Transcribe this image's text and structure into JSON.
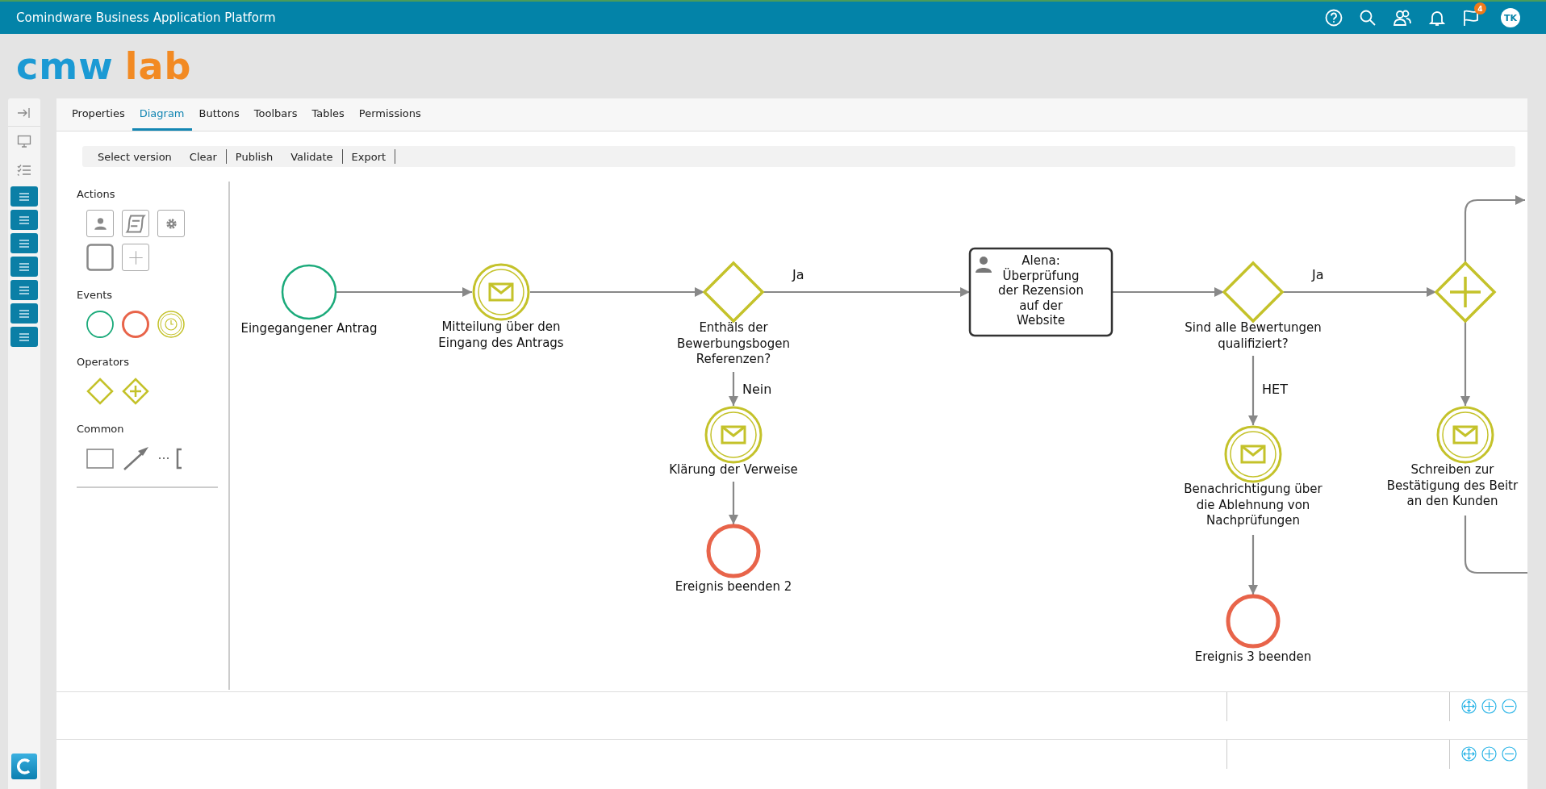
{
  "topbar": {
    "title": "Comindware Business Application Platform",
    "badge": "4",
    "user_initials": "TK"
  },
  "logo": {
    "part_1": "cmw",
    "part_2": "lab"
  },
  "rail": [
    {
      "kind": "collapse"
    },
    {
      "kind": "monitor"
    },
    {
      "kind": "checklist"
    },
    {
      "kind": "menu"
    },
    {
      "kind": "menu"
    },
    {
      "kind": "menu"
    },
    {
      "kind": "menu"
    },
    {
      "kind": "menu"
    },
    {
      "kind": "menu"
    },
    {
      "kind": "menu"
    },
    {
      "kind": "app"
    }
  ],
  "tabs": [
    {
      "label": "Properties",
      "selected": false
    },
    {
      "label": "Diagram",
      "selected": true
    },
    {
      "label": "Buttons",
      "selected": false
    },
    {
      "label": "Toolbars",
      "selected": false
    },
    {
      "label": "Tables",
      "selected": false
    },
    {
      "label": "Permissions",
      "selected": false
    }
  ],
  "toolbar": [
    {
      "label": "Select version",
      "separator": false
    },
    {
      "label": "Clear",
      "separator": true
    },
    {
      "label": "Publish",
      "separator": false
    },
    {
      "label": "Validate",
      "separator": true
    },
    {
      "label": "Export",
      "separator": true
    }
  ],
  "palette": [
    {
      "title": "Actions",
      "items": [
        {
          "kind": "user-task"
        },
        {
          "kind": "script-task"
        },
        {
          "kind": "service-task"
        },
        {
          "kind": "task"
        },
        {
          "kind": "add"
        }
      ]
    },
    {
      "title": "Events",
      "items": [
        {
          "kind": "start"
        },
        {
          "kind": "end"
        },
        {
          "kind": "timer"
        }
      ]
    },
    {
      "title": "Operators",
      "items": [
        {
          "kind": "gateway"
        },
        {
          "kind": "parallel"
        }
      ]
    },
    {
      "title": "Common",
      "items": [
        {
          "kind": "rectangle"
        },
        {
          "kind": "arrow"
        },
        {
          "kind": "annotation"
        }
      ]
    }
  ],
  "diagram": {
    "nodes": [
      {
        "kind": "start",
        "label": "Eingegangener Antrag"
      },
      {
        "kind": "message",
        "label": "Mitteilung über den\nEingang des Antrags"
      },
      {
        "kind": "gateway",
        "label": "Enthäls der\nBewerbungsbogen\nReferenzen?"
      },
      {
        "kind": "message",
        "label": "Klärung der Verweise"
      },
      {
        "kind": "end",
        "label": "Ereignis beenden 2"
      },
      {
        "kind": "task",
        "label": "Alena:\nÜberprüfung\nder Rezension\nauf der\nWebsite"
      },
      {
        "kind": "gateway",
        "label": "Sind alle Bewertungen\nqualifiziert?"
      },
      {
        "kind": "message",
        "label": "Benachrichtigung über\ndie Ablehnung von\nNachprüfungen"
      },
      {
        "kind": "end",
        "label": "Ereignis 3 beenden"
      },
      {
        "kind": "parallel"
      },
      {
        "kind": "message",
        "label": "Schreiben zur\nBestätigung des Beitr\nan den Kunden"
      }
    ],
    "flow_labels": [
      "Ja",
      "Nein",
      "Ja",
      "НЕТ"
    ]
  }
}
